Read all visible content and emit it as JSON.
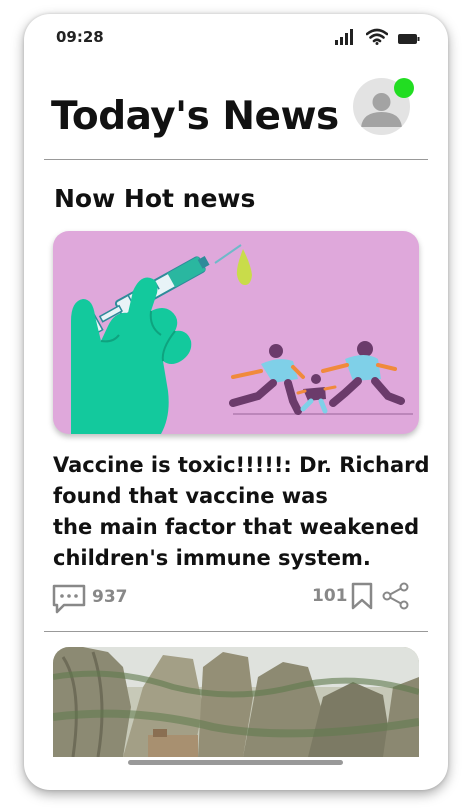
{
  "status_bar": {
    "time": "09:28"
  },
  "header": {
    "title": "Today's News"
  },
  "section": {
    "title": "Now Hot news"
  },
  "article": {
    "headline_lines": [
      "Vaccine is toxic!!!!!: Dr. Richard",
      "found that vaccine was",
      "the main factor that weakened",
      "children's immune system."
    ],
    "comments": "937",
    "likes": "101"
  },
  "colors": {
    "online_dot": "#22dd22",
    "hero_background": "#dfa8db",
    "muted_text": "#888888"
  },
  "icons": [
    "signal-icon",
    "wifi-icon",
    "battery-icon",
    "comment-icon",
    "bookmark-icon",
    "share-icon"
  ]
}
